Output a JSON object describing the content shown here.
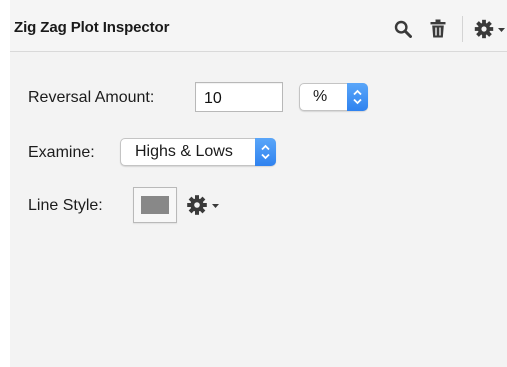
{
  "inspector": {
    "title": "Zig Zag Plot Inspector",
    "toolbar_icons": [
      "search-icon",
      "trash-icon",
      "gear-icon",
      "chevron-down-icon"
    ]
  },
  "fields": {
    "reversal_label": "Reversal Amount:",
    "reversal_value": "10",
    "reversal_unit": "%",
    "examine_label": "Examine:",
    "examine_value": "Highs & Lows",
    "line_style_label": "Line Style:",
    "line_color": "#888888"
  },
  "colors": {
    "accent": "#3b8ff5",
    "panel_bg": "#f3f3f3"
  }
}
